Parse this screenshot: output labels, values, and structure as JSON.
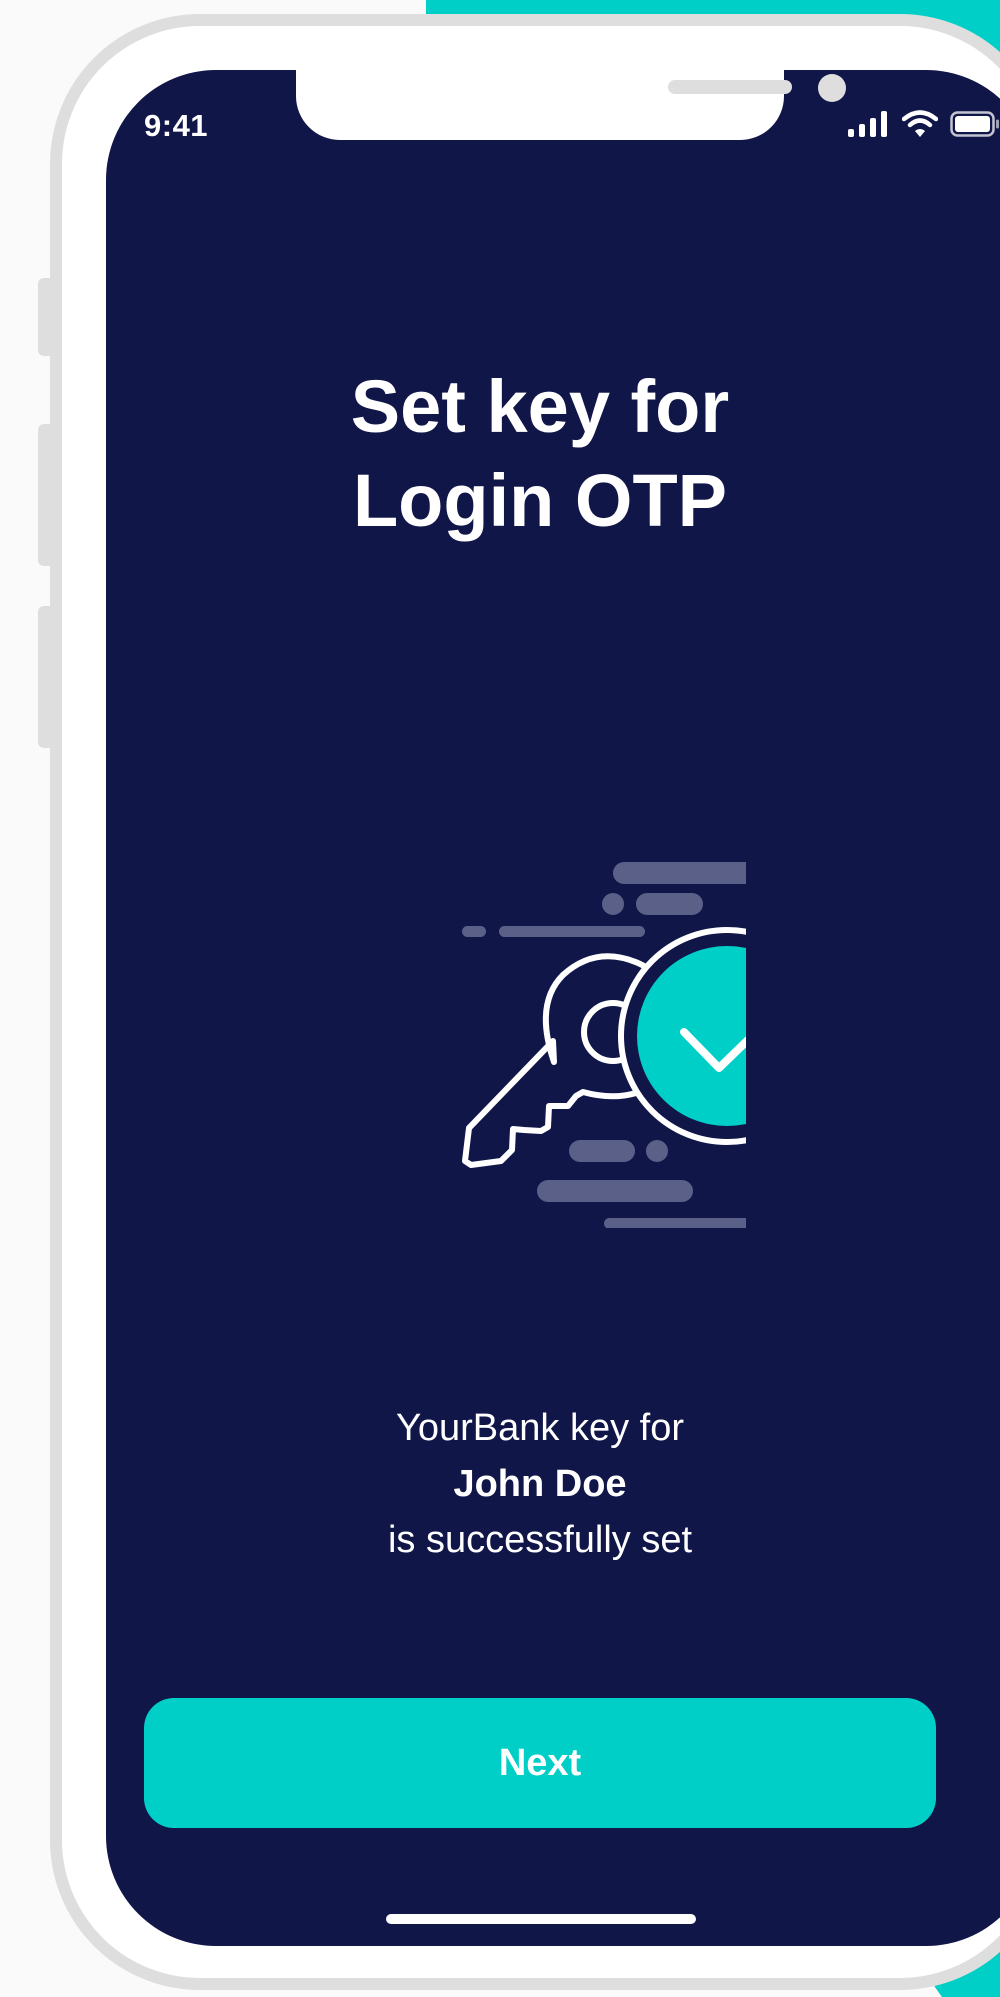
{
  "status_bar": {
    "time": "9:41"
  },
  "screen": {
    "title_line1": "Set key for",
    "title_line2": "Login OTP",
    "message_line1": "YourBank key for",
    "message_name": "John Doe",
    "message_line3": "is successfully set",
    "next_label": "Next"
  },
  "colors": {
    "background": "#111649",
    "accent": "#00cfc8",
    "text": "#ffffff",
    "muted_line": "#5b6088"
  },
  "icons": {
    "illustration": "key-checkmark-icon",
    "signal": "cellular-signal-icon",
    "wifi": "wifi-icon",
    "battery": "battery-icon"
  }
}
